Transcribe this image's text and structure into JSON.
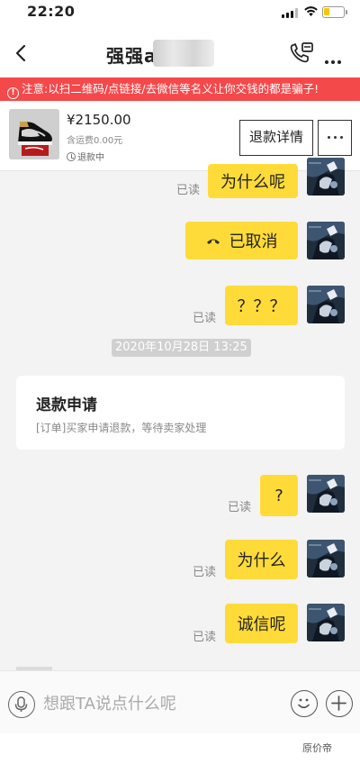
{
  "status_bar": {
    "time": "22:20",
    "battery_level": 0.3
  },
  "header": {
    "title": "强强a",
    "back_icon": "chevron-left-icon",
    "call_icon": "phone-icon",
    "more_icon": "ellipsis-icon"
  },
  "warning": {
    "text": "注意:以扫二维码/点链接/去微信等名义让你交钱的都是骗子!",
    "icon": "exclamation-circle-icon"
  },
  "product": {
    "price": "¥2150.00",
    "shipping": "含运费0.00元",
    "status": "退款中",
    "refund_button": "退款详情",
    "more_icon": "ellipsis-icon"
  },
  "messages": [
    {
      "text": "为什么呢",
      "read": "已读"
    },
    {
      "text": "已取消",
      "call_icon": "hang-up-icon"
    },
    {
      "text": "？？？",
      "read": "已读"
    },
    {
      "timestamp": "2020年10月28日 13:25"
    },
    {
      "card_title": "退款申请",
      "card_text": "[订单]买家申请退款，等待卖家处理"
    },
    {
      "text": "?",
      "read": "已读"
    },
    {
      "text": "为什么",
      "read": "已读"
    },
    {
      "text": "诚信呢",
      "read": "已读"
    }
  ],
  "input": {
    "placeholder": "想跟TA说点什么呢",
    "mic_icon": "microphone-icon",
    "emoji_icon": "smiley-icon",
    "plus_icon": "plus-circle-icon"
  },
  "watermark": "原价帝",
  "colors": {
    "warning_bg": "#f4494b",
    "bubble": "#ffdb3a",
    "background": "#f3f3f3"
  }
}
